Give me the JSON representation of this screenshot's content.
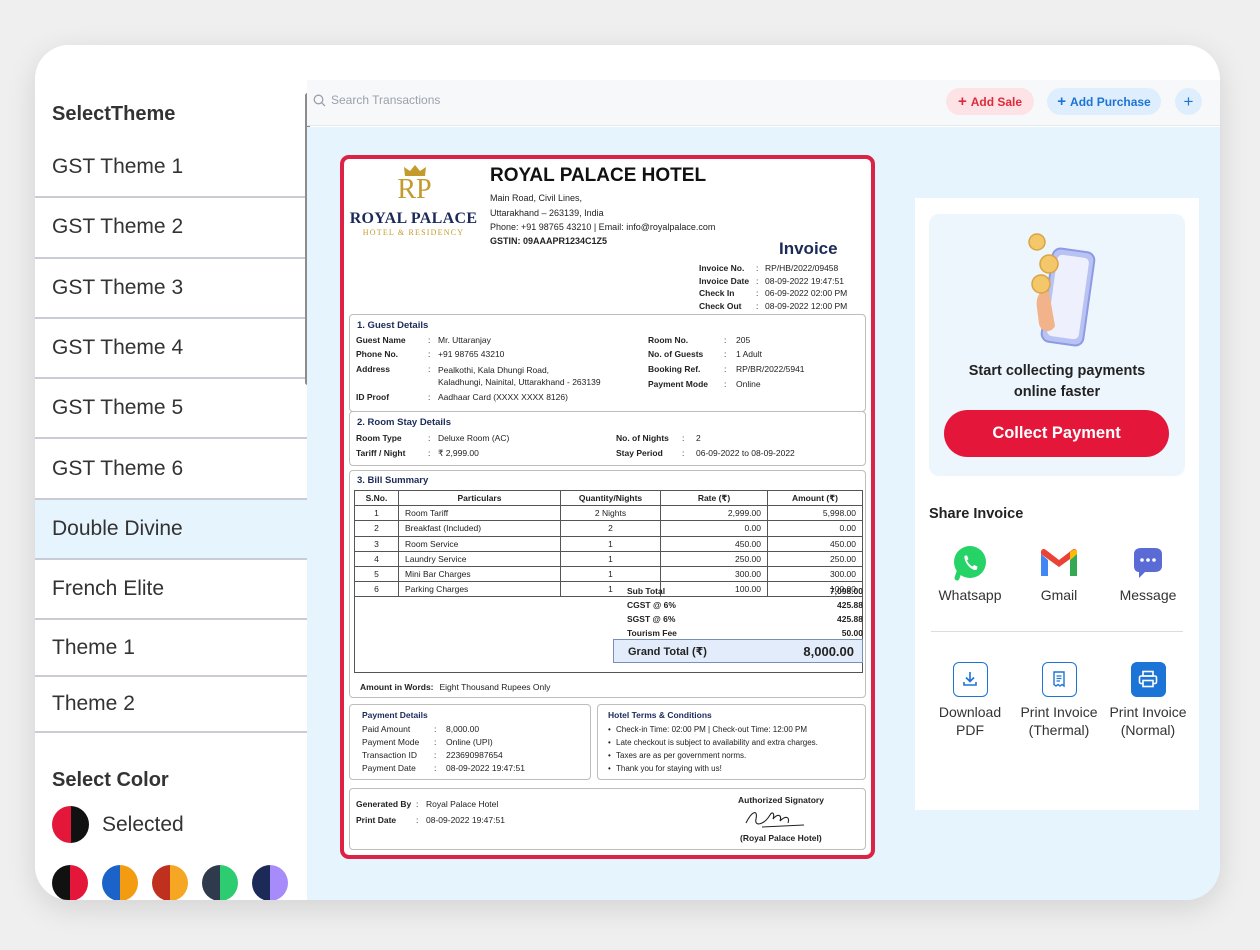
{
  "sidebar": {
    "title": "SelectTheme",
    "themes": [
      {
        "label": "GST Theme 1"
      },
      {
        "label": "GST Theme 2"
      },
      {
        "label": "GST Theme 3"
      },
      {
        "label": "GST Theme 4"
      },
      {
        "label": "GST Theme 5"
      },
      {
        "label": "GST Theme 6"
      },
      {
        "label": "Double Divine",
        "active": true
      },
      {
        "label": "French Elite"
      },
      {
        "label": "Theme 1"
      },
      {
        "label": "Theme 2"
      }
    ],
    "color_title": "Select Color",
    "selected_label": "Selected",
    "selected_colors": [
      "#e4173b",
      "#111111"
    ],
    "swatches": [
      [
        "#111111",
        "#e4173b"
      ],
      [
        "#1b63c8",
        "#f39c12"
      ],
      [
        "#c0301f",
        "#f5a623"
      ],
      [
        "#2f3b4c",
        "#2ecc71"
      ],
      [
        "#1c2a58",
        "#a78bfa"
      ]
    ]
  },
  "topbar": {
    "search_placeholder": "Search Transactions",
    "add_sale": "Add Sale",
    "add_purchase": "Add Purchase",
    "plus": "+"
  },
  "invoice": {
    "logo_initials": "RP",
    "logo_name": "ROYAL PALACE",
    "logo_sub": "HOTEL & RESIDENCY",
    "hotel_name": "ROYAL PALACE HOTEL",
    "address1": "Main Road, Civil Lines,",
    "address2": "Uttarakhand – 263139, India",
    "contact": "Phone: +91 98765 43210   |   Email: info@royalpalace.com",
    "gstin": "GSTIN: 09AAAPR1234C1Z5",
    "title": "Invoice",
    "meta": [
      {
        "k": "Invoice No.",
        "v": "RP/HB/2022/09458"
      },
      {
        "k": "Invoice Date",
        "v": "08-09-2022 19:47:51"
      },
      {
        "k": "Check In",
        "v": "06-09-2022 02:00 PM"
      },
      {
        "k": "Check Out",
        "v": "08-09-2022 12:00 PM"
      }
    ],
    "guest_title": "1. Guest Details",
    "guest_left": [
      {
        "k": "Guest Name",
        "v": "Mr. Uttaranjay"
      },
      {
        "k": "Phone No.",
        "v": "+91 98765 43210"
      },
      {
        "k": "Address",
        "v": "Pealkothi, Kala Dhungi Road,",
        "v2": "Kaladhungi, Nainital, Uttarakhand - 263139"
      },
      {
        "k": "ID Proof",
        "v": "Aadhaar Card (XXXX XXXX 8126)"
      }
    ],
    "guest_right": [
      {
        "k": "Room No.",
        "v": "205"
      },
      {
        "k": "No. of Guests",
        "v": "1 Adult"
      },
      {
        "k": "Booking Ref.",
        "v": "RP/BR/2022/5941"
      },
      {
        "k": "Payment Mode",
        "v": "Online"
      }
    ],
    "stay_title": "2. Room Stay Details",
    "stay": {
      "room_type_k": "Room Type",
      "room_type_v": "Deluxe Room (AC)",
      "tariff_k": "Tariff / Night",
      "tariff_v": "₹ 2,999.00",
      "nights_k": "No. of Nights",
      "nights_v": "2",
      "period_k": "Stay Period",
      "period_v": "06-09-2022 to 08-09-2022"
    },
    "bill_title": "3. Bill Summary",
    "columns": [
      "S.No.",
      "Particulars",
      "Quantity/Nights",
      "Rate (₹)",
      "Amount (₹)"
    ],
    "items": [
      {
        "sno": "1",
        "name": "Room Tariff",
        "qty": "2 Nights",
        "rate": "2,999.00",
        "amount": "5,998.00"
      },
      {
        "sno": "2",
        "name": "Breakfast (Included)",
        "qty": "2",
        "rate": "0.00",
        "amount": "0.00"
      },
      {
        "sno": "3",
        "name": "Room Service",
        "qty": "1",
        "rate": "450.00",
        "amount": "450.00"
      },
      {
        "sno": "4",
        "name": "Laundry Service",
        "qty": "1",
        "rate": "250.00",
        "amount": "250.00"
      },
      {
        "sno": "5",
        "name": "Mini Bar Charges",
        "qty": "1",
        "rate": "300.00",
        "amount": "300.00"
      },
      {
        "sno": "6",
        "name": "Parking Charges",
        "qty": "1",
        "rate": "100.00",
        "amount": "100.00"
      }
    ],
    "totals": [
      {
        "k": "Sub Total",
        "v": "7,098.00"
      },
      {
        "k": "CGST @ 6%",
        "v": "425.88"
      },
      {
        "k": "SGST @ 6%",
        "v": "425.88"
      },
      {
        "k": "Tourism Fee",
        "v": "50.00"
      }
    ],
    "grand_k": "Grand Total (₹)",
    "grand_v": "8,000.00",
    "words_k": "Amount in Words:",
    "words_v": "Eight Thousand Rupees Only",
    "payment_title": "Payment Details",
    "payment": [
      {
        "k": "Paid Amount",
        "v": "8,000.00"
      },
      {
        "k": "Payment Mode",
        "v": "Online (UPI)"
      },
      {
        "k": "Transaction ID",
        "v": "223690987654"
      },
      {
        "k": "Payment Date",
        "v": "08-09-2022 19:47:51"
      }
    ],
    "terms_title": "Hotel Terms & Conditions",
    "terms": [
      "Check-in Time: 02:00 PM | Check-out Time: 12:00 PM",
      "Late checkout is subject to availability and extra charges.",
      "Taxes are as per government norms.",
      "Thank you for staying with us!"
    ],
    "generated_k": "Generated By",
    "generated_v": "Royal Palace Hotel",
    "print_k": "Print Date",
    "print_v": "08-09-2022 19:47:51",
    "auth_label": "Authorized Signatory",
    "auth_sub": "(Royal Palace Hotel)"
  },
  "panel": {
    "promo_line1": "Start collecting payments",
    "promo_line2": "online faster",
    "collect_label": "Collect Payment",
    "share_title": "Share Invoice",
    "share": [
      {
        "label": "Whatsapp",
        "icon": "whatsapp-icon"
      },
      {
        "label": "Gmail",
        "icon": "gmail-icon"
      },
      {
        "label": "Message",
        "icon": "message-icon"
      }
    ],
    "actions": [
      {
        "line1": "Download",
        "line2": "PDF",
        "icon": "download-icon"
      },
      {
        "line1": "Print Invoice",
        "line2": "(Thermal)",
        "icon": "thermal-print-icon"
      },
      {
        "line1": "Print Invoice",
        "line2": "(Normal)",
        "icon": "print-icon"
      }
    ]
  }
}
